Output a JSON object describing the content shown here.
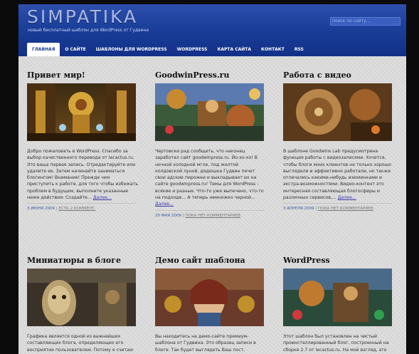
{
  "header": {
    "logo": "SIMPATIKA",
    "tagline": "новый бесплатный шаблон для WordPress от Гудвина",
    "search_placeholder": "поиск по сайту..."
  },
  "nav": [
    {
      "label": "Главная"
    },
    {
      "label": "О сайте"
    },
    {
      "label": "Шаблоны для WordPress"
    },
    {
      "label": "WordPress"
    },
    {
      "label": "Карта сайта"
    },
    {
      "label": "Контакт"
    },
    {
      "label": "RSS"
    }
  ],
  "posts": [
    {
      "title": "Привет мир!",
      "excerpt": "Добро пожаловать в WordPress. Спасибо за выбор качественного перевода от lecactus.ru. Это ваша первая запись. Отредактируйте или удалите ее. Затем начинайте заниматься блогингом! Внимание! Прежде чем приступить к работе, для того чтобы избежать проблем в будущем, выполните указанные ниже действия: Создайте...",
      "more": "Далее...",
      "date": "3 июня 2009",
      "comments": "Есть 2 коммент."
    },
    {
      "title": "GoodwinPress.ru",
      "excerpt": "Чертовски рад сообщить, что наконец заработал сайт goodwinpress.ru. Йо-хо-хо! В ночной холодной мгле, под желтой колдовской луной, дядюшка Гудвин печет свои адские пирожки и выкладывает их на сайте goodwinpress.ru! Темы для WordPress - всякие и разные. Что-то уже выпечено, что-то на подходе... А теперь немножко черной...",
      "more": "Далее...",
      "date": "20 мая 2009",
      "comments": "Пока нет комментариев"
    },
    {
      "title": "Работа с видео",
      "excerpt": "В шаблоне Goodwins Lab предусмотрена функция работы с видеозаписями. Хочется, чтобы блоги моих клиентов не только хорошо выглядели и эффективно работали, но также отличались какими-нибудь изюминками и экстра-возможностями. Видео-контент это интересная составляющая блогосферы и различных сервисов,...",
      "more": "Далее...",
      "date": "3 апреля 2009",
      "comments": "Пока нет комментариев"
    },
    {
      "title": "Миниатюры в блоге",
      "excerpt": "Графика является одной из важнейших составляющих блога, определяющих его восприятие пользователем. Потому я считаю",
      "more": "",
      "date": "",
      "comments": ""
    },
    {
      "title": "Демо сайт шаблона",
      "excerpt": "Вы находитесь на демо-сайте премиум-шаблона от Гудвина. Это образец записи в блоге. Так будет выглядеть Ваш пост. Принцип построения",
      "more": "",
      "date": "",
      "comments": ""
    },
    {
      "title": "WordPress",
      "excerpt": "Этот шаблон был установлен на чистый проинсталлированный блог, построенный на сборке 2.7 от lecactus.ru. На мой взгляд, это",
      "more": "",
      "date": "",
      "comments": ""
    }
  ],
  "colors": {
    "header_blue": "#1a3f9a",
    "link": "#3a3aaa"
  }
}
